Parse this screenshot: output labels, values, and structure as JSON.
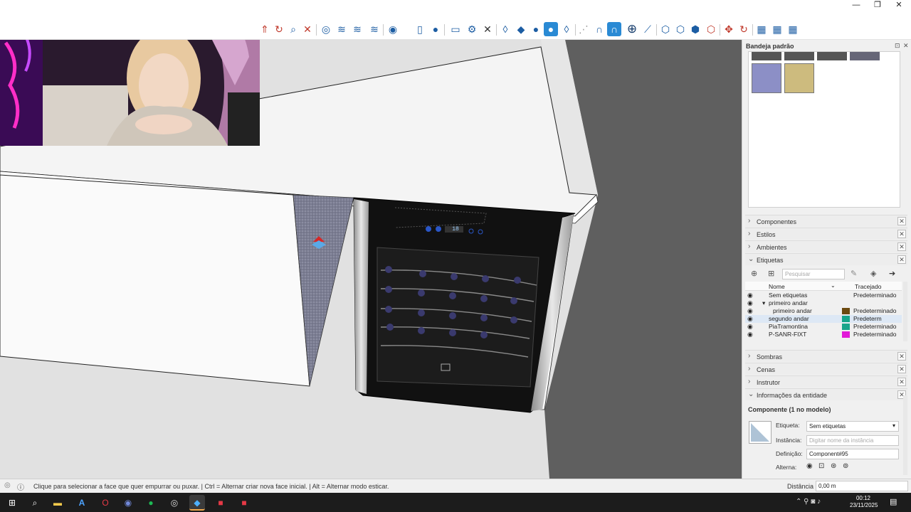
{
  "window": {
    "controls": [
      "—",
      "❐",
      "✕"
    ]
  },
  "toolbar": {
    "icons": [
      "push-pull-icon",
      "rotate-icon",
      "scale-icon",
      "zoom-icon",
      "zoom-extents-icon",
      "orbit-icon",
      "pan-icon",
      "section-plane-icon",
      "axes-icon",
      "walk-icon",
      "page-icon",
      "person-icon",
      "rectangle-icon",
      "gear-icon",
      "erase-icon",
      "water-drop-icon",
      "water-drop-filled-icon",
      "water-drop-solid-icon",
      "water-drop-active-icon",
      "water-drop-outline-icon",
      "wand-icon",
      "magnet-icon",
      "magnet-active-icon",
      "add-icon",
      "line-icon",
      "box-icon",
      "box-alt-icon",
      "box-filled-icon",
      "cancel-box-icon",
      "move-icon",
      "refresh-icon",
      "grid-icon",
      "grid-alt-icon",
      "grid-blue-icon"
    ]
  },
  "tray": {
    "title": "Bandeja padrão",
    "sections_top": [
      {
        "label": "Componentes",
        "expanded": false
      },
      {
        "label": "Estilos",
        "expanded": false
      },
      {
        "label": "Ambientes",
        "expanded": false
      },
      {
        "label": "Etiquetas",
        "expanded": true
      }
    ],
    "etiquetas": {
      "search_placeholder": "Pesquisar",
      "col_name": "Nome",
      "col_trace": "Tracejado",
      "rows": [
        {
          "name": "Sem etiquetas",
          "trace": "Predeterminado",
          "color": "",
          "indent": 0
        },
        {
          "name": "primeiro andar",
          "trace": "",
          "color": "",
          "indent": 0,
          "group": true
        },
        {
          "name": "primeiro andar",
          "trace": "Predeterminado",
          "color": "#6b4a10",
          "indent": 1
        },
        {
          "name": "segundo andar",
          "trace": "Predeterm",
          "color": "#16a58a",
          "indent": 0,
          "selected": true
        },
        {
          "name": "PiaTramontina",
          "trace": "Predeterminado",
          "color": "#1aa58c",
          "indent": 0
        },
        {
          "name": "P-SANR-FIXT",
          "trace": "Predeterminado",
          "color": "#e21ad8",
          "indent": 0
        }
      ]
    },
    "sections_bottom": [
      {
        "label": "Sombras",
        "expanded": false
      },
      {
        "label": "Cenas",
        "expanded": false
      },
      {
        "label": "Instrutor",
        "expanded": false
      },
      {
        "label": "Informações da entidade",
        "expanded": true
      }
    ],
    "entity": {
      "header": "Componente (1 no modelo)",
      "tag_label": "Etiqueta:",
      "tag_value": "Sem etiquetas",
      "instance_label": "Instância:",
      "instance_placeholder": "Digitar nome da instância",
      "definition_label": "Definição:",
      "definition_value": "Component#95",
      "toggle_label": "Alterna:"
    }
  },
  "statusbar": {
    "hint": "Clique para selecionar a face que quer empurrar ou puxar. | Ctrl = Alternar criar nova face inicial. | Alt = Alternar modo esticar.",
    "measure_label": "Distância",
    "measure_value": "0,00 m"
  },
  "taskbar": {
    "time": "00:12",
    "date": "23/11/2025",
    "apps": [
      "start-icon",
      "search-icon",
      "file-explorer-icon",
      "app-a-icon",
      "opera-icon",
      "discord-icon",
      "spotify-icon",
      "obs-icon",
      "sketchup-icon",
      "layout-icon",
      "style-builder-icon"
    ]
  },
  "cooler": {
    "display_value": "18"
  },
  "colors": {
    "accent": "#2a8ad4",
    "selected_row": "#dde8f5",
    "viewport_bg": "#e1e1e1"
  }
}
